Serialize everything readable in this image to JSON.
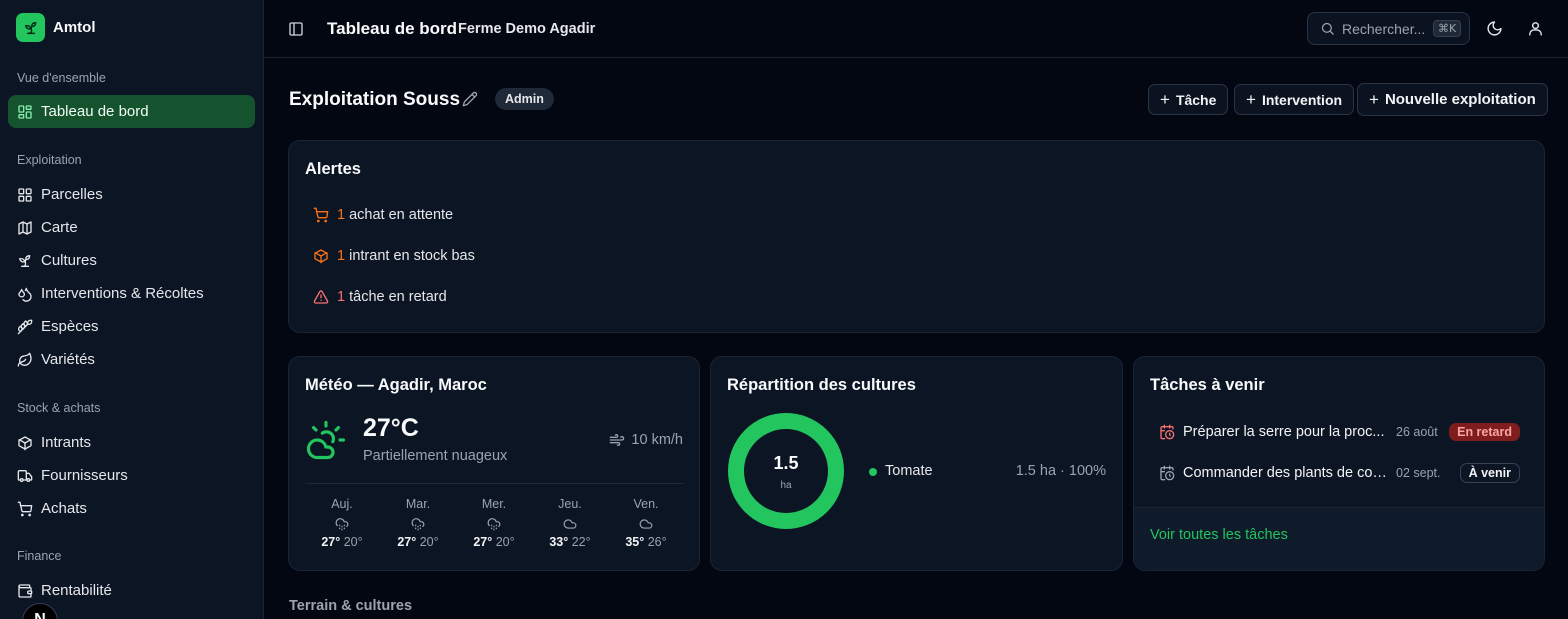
{
  "app": {
    "name": "Amtol"
  },
  "sidebar": {
    "sections": [
      {
        "label": "Vue d'ensemble"
      },
      {
        "label": "Exploitation"
      },
      {
        "label": "Stock & achats"
      },
      {
        "label": "Finance"
      }
    ],
    "items": [
      {
        "label": "Tableau de bord",
        "icon": "layout-dashboard-icon",
        "active": true
      },
      {
        "label": "Parcelles",
        "icon": "grid-icon"
      },
      {
        "label": "Carte",
        "icon": "map-icon"
      },
      {
        "label": "Cultures",
        "icon": "sprout-icon"
      },
      {
        "label": "Interventions & Récoltes",
        "icon": "droplets-icon"
      },
      {
        "label": "Espèces",
        "icon": "wheat-icon"
      },
      {
        "label": "Variétés",
        "icon": "leaf-icon"
      },
      {
        "label": "Intrants",
        "icon": "package-icon"
      },
      {
        "label": "Fournisseurs",
        "icon": "truck-icon"
      },
      {
        "label": "Achats",
        "icon": "cart-icon"
      },
      {
        "label": "Rentabilité",
        "icon": "wallet-icon"
      }
    ],
    "user_initial": "N"
  },
  "header": {
    "title": "Tableau de bord",
    "farm": "Ferme Demo Agadir",
    "search_placeholder": "Rechercher...",
    "search_shortcut": "⌘K"
  },
  "page": {
    "title": "Exploitation Souss",
    "role_badge": "Admin",
    "actions": {
      "task": "Tâche",
      "intervention": "Intervention",
      "new_farm": "Nouvelle exploitation"
    }
  },
  "alerts": {
    "title": "Alertes",
    "items": [
      {
        "count": "1",
        "text": "achat en attente",
        "icon": "cart-icon"
      },
      {
        "count": "1",
        "text": "intrant en stock bas",
        "icon": "package-icon"
      },
      {
        "count": "1",
        "text": "tâche en retard",
        "icon": "alert-triangle-icon"
      }
    ]
  },
  "weather": {
    "title": "Météo — Agadir, Maroc",
    "temp": "27°C",
    "description": "Partiellement nuageux",
    "wind": "10 km/h",
    "forecast": [
      {
        "day": "Auj.",
        "max": "27°",
        "min": "20°",
        "icon": "cloud-drizzle-icon"
      },
      {
        "day": "Mar.",
        "max": "27°",
        "min": "20°",
        "icon": "cloud-drizzle-icon"
      },
      {
        "day": "Mer.",
        "max": "27°",
        "min": "20°",
        "icon": "cloud-drizzle-icon"
      },
      {
        "day": "Jeu.",
        "max": "33°",
        "min": "22°",
        "icon": "cloud-icon"
      },
      {
        "day": "Ven.",
        "max": "35°",
        "min": "26°",
        "icon": "cloud-icon"
      }
    ]
  },
  "crops": {
    "title": "Répartition des cultures",
    "total": "1.5",
    "unit": "ha",
    "color": "#22c55e",
    "legend": [
      {
        "name": "Tomate",
        "value": "1.5 ha · 100%",
        "share": 1.0
      }
    ]
  },
  "tasks": {
    "title": "Tâches à venir",
    "items": [
      {
        "name": "Préparer la serre pour la proc...",
        "date": "26 août",
        "status": "En retard"
      },
      {
        "name": "Commander des plants de cou...",
        "date": "02 sept.",
        "status": "À venir"
      }
    ],
    "link": "Voir toutes les tâches"
  },
  "section_below": "Terrain & cultures"
}
